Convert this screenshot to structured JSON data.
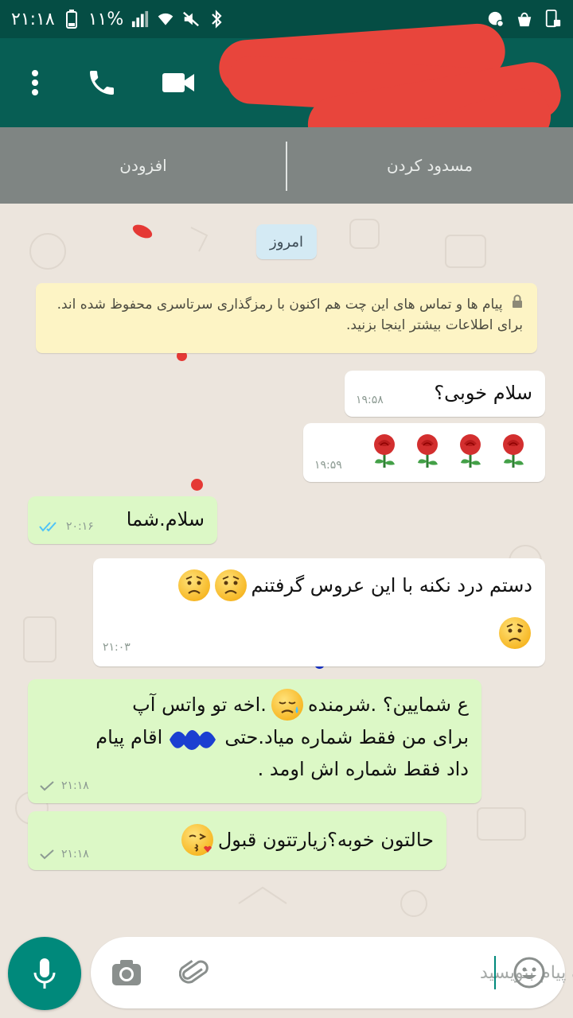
{
  "status_bar": {
    "time": "۲۱:۱۸",
    "battery": "۱۱%"
  },
  "header": {
    "actions": [
      "more-menu",
      "voice-call",
      "video-call"
    ]
  },
  "action_strip": {
    "add_label": "افزودن",
    "block_label": "مسدود کردن"
  },
  "chat": {
    "date_chip": "امروز",
    "encryption_notice": "پیام ها و تماس های  این چت هم اکنون با رمزگذاری سرتاسری محفوظ شده اند. برای اطلاعات بیشتر اینجا بزنید.",
    "messages": [
      {
        "direction": "incoming",
        "text": "سلام خوبی؟",
        "time": "۱۹:۵۸"
      },
      {
        "direction": "incoming",
        "text": "",
        "emoji": [
          "rose",
          "rose",
          "rose",
          "rose"
        ],
        "time": "۱۹:۵۹"
      },
      {
        "direction": "outgoing",
        "text": "سلام.شما",
        "time": "۲۰:۱۶",
        "status": "read"
      },
      {
        "direction": "incoming",
        "text": "دستم درد نکنه با این عروس گرفتنم",
        "emoji": [
          "worried-face",
          "worried-face",
          "worried-face"
        ],
        "time": "۲۱:۰۳"
      },
      {
        "direction": "outgoing",
        "line1": "ع  شمایین؟ .شرمنده",
        "line1b": ".اخه تو واتس آپ",
        "line2": "برای من فقط شماره میاد.حتی",
        "line2b": "اقام پیام",
        "line3": "داد فقط شماره اش اومد .",
        "emoji": [
          "sad-sweat-face"
        ],
        "time": "۲۱:۱۸",
        "status": "sent"
      },
      {
        "direction": "outgoing",
        "text": "حالتون خوبه؟زیارتتون قبول",
        "emoji": [
          "kissing-face"
        ],
        "time": "۲۱:۱۸",
        "status": "sent"
      }
    ]
  },
  "composer": {
    "placeholder": "یک پیام بنویسید",
    "value": ""
  },
  "colors": {
    "header": "#075e54",
    "status_bar": "#054d44",
    "outgoing_bubble": "#dcf8c6",
    "incoming_bubble": "#ffffff",
    "accent": "#00897b",
    "read_tick": "#4fc3f7"
  }
}
